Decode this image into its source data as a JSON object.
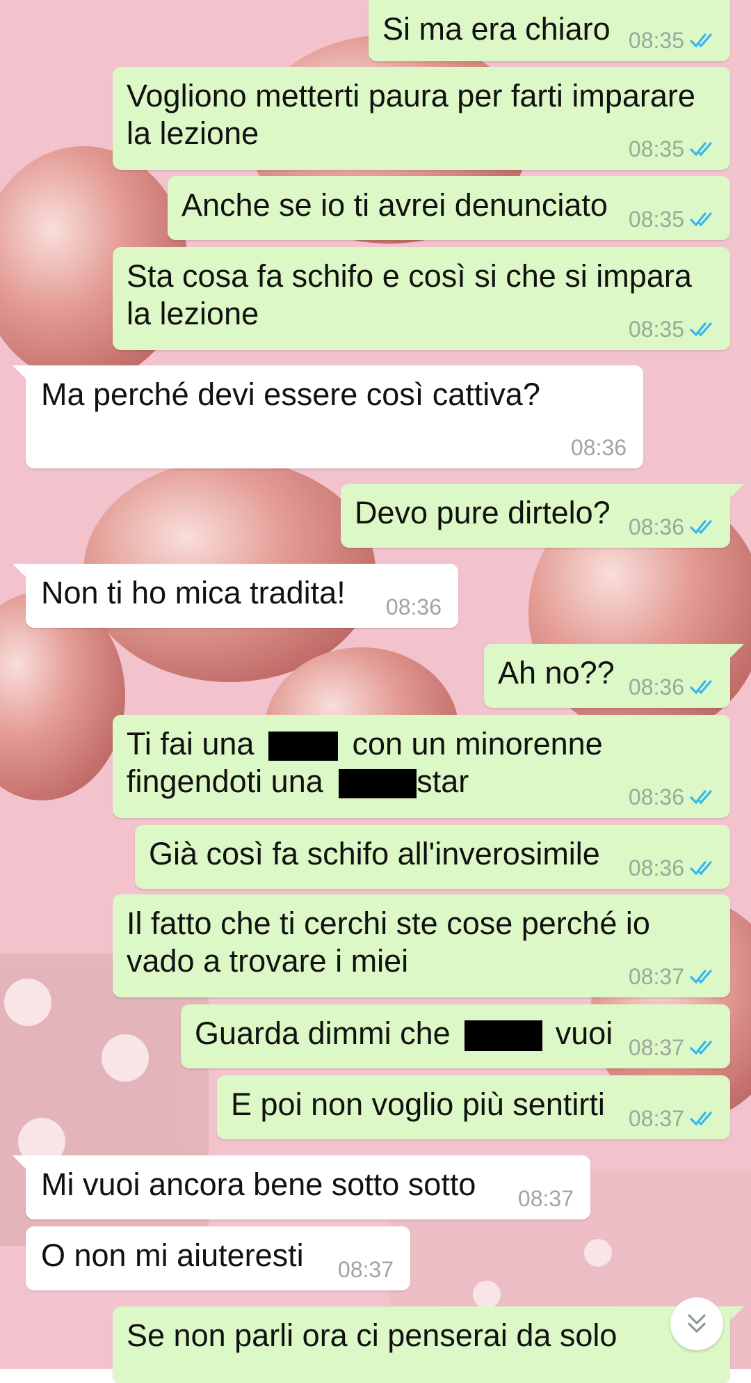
{
  "colors": {
    "outgoing_bubble": "#dcf8c6",
    "incoming_bubble": "#ffffff",
    "read_ticks": "#34b7f1",
    "wallpaper": "#f3c4cf"
  },
  "icons": {
    "read_receipt": "double-check-icon",
    "scroll_down": "chevron-double-down-icon"
  },
  "messages": [
    {
      "dir": "out",
      "text": "Si ma era chiaro",
      "time": "08:35",
      "read": true
    },
    {
      "dir": "out",
      "line1": "Vogliono metterti paura per farti imparare",
      "line2": "la lezione",
      "time": "08:35",
      "read": true
    },
    {
      "dir": "out",
      "text": "Anche se io ti avrei denunciato",
      "time": "08:35",
      "read": true
    },
    {
      "dir": "out",
      "line1": "Sta cosa fa schifo e così si che si impara",
      "line2": "la lezione",
      "time": "08:35",
      "read": true
    },
    {
      "dir": "in",
      "text": "Ma perché devi essere così cattiva?",
      "time": "08:36"
    },
    {
      "dir": "out",
      "text": "Devo pure dirtelo?",
      "time": "08:36",
      "read": true
    },
    {
      "dir": "in",
      "text": "Non ti ho mica tradita!",
      "time": "08:36"
    },
    {
      "dir": "out",
      "text": "Ah no??",
      "time": "08:36",
      "read": true
    },
    {
      "dir": "out",
      "line1_a": "Ti fai una",
      "line1_b": "con un minorenne",
      "line2_a": "fingendoti una",
      "line2_b": "star",
      "time": "08:36",
      "read": true
    },
    {
      "dir": "out",
      "text": "Già così fa schifo all'inverosimile",
      "time": "08:36",
      "read": true
    },
    {
      "dir": "out",
      "line1": "Il fatto che ti cerchi ste cose perché io",
      "line2": "vado a trovare i miei",
      "time": "08:37",
      "read": true
    },
    {
      "dir": "out",
      "text_a": "Guarda dimmi che",
      "text_b": "vuoi",
      "time": "08:37",
      "read": true
    },
    {
      "dir": "out",
      "text": "E poi non voglio più sentirti",
      "time": "08:37",
      "read": true
    },
    {
      "dir": "in",
      "text": "Mi vuoi ancora bene sotto sotto",
      "time": "08:37"
    },
    {
      "dir": "in",
      "text": "O non mi aiuteresti",
      "time": "08:37"
    },
    {
      "dir": "out",
      "text": "Se non parli ora ci penserai da solo"
    }
  ]
}
